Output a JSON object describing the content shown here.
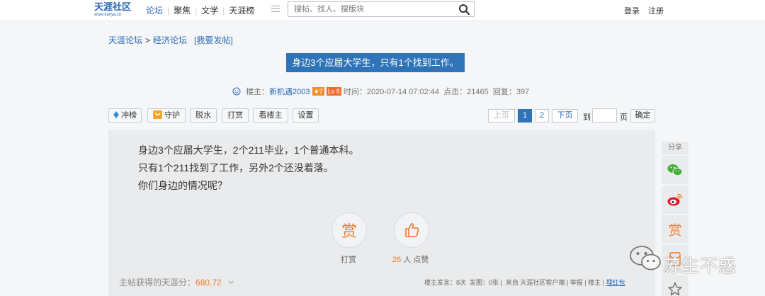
{
  "header": {
    "logo": {
      "name": "天涯社区",
      "url_text": "www.tianya.cn"
    },
    "nav": [
      {
        "label": "论坛",
        "active": true
      },
      {
        "label": "聚焦"
      },
      {
        "label": "文学"
      },
      {
        "label": "天涯榜"
      }
    ],
    "search_placeholder": "搜帖、找人、搜版块",
    "login": "登录",
    "register": "注册"
  },
  "breadcrumb": {
    "root": "天涯论坛",
    "sep": ">",
    "section": "经济论坛",
    "post_link": "[我要发帖]"
  },
  "post": {
    "title": "身边3个应届大学生，只有1个找到工作。",
    "meta": {
      "owner_label": "楼主：",
      "owner": "新机遇2003",
      "badge_star": "★7",
      "badge_level": "Lv 8",
      "time": "时间：2020-07-14 07:02:44",
      "clicks": "点击：21465",
      "replies": "回复：397"
    },
    "actions": [
      "冲榜",
      "守护",
      "脱水",
      "打赏",
      "看楼主",
      "设置"
    ],
    "body_lines": [
      "身边3个应届大学生，2个211毕业，1个普通本科。",
      "只有1个211找到了工作，另外2个还没着落。",
      "你们身边的情况呢？"
    ],
    "reward_label": "打赏",
    "like_count": "26",
    "like_label": "人 点赞",
    "score_label": "主帖获得的天涯分：",
    "score_value": "680.72",
    "footer": {
      "posts": "楼主发言：8次",
      "images": "发图：0张",
      "from": "来自 天涯社区客户端",
      "links": [
        "举报",
        "楼主"
      ],
      "red_packet": "埋红包"
    }
  },
  "pagination": {
    "prev": "上页",
    "pages": [
      "1",
      "2"
    ],
    "current": "1",
    "next": "下页",
    "goto_label": "到",
    "page_unit": "页",
    "confirm": "确定"
  },
  "share": {
    "label": "分享",
    "reward_icon_text": "赏"
  },
  "watermark": {
    "text": "苏生不惑"
  },
  "colors": {
    "brand_blue": "#2f73b8",
    "link_blue": "#2b68b6",
    "orange": "#ef7b2f",
    "wechat_green": "#41b035",
    "weibo_red": "#e6162d"
  }
}
